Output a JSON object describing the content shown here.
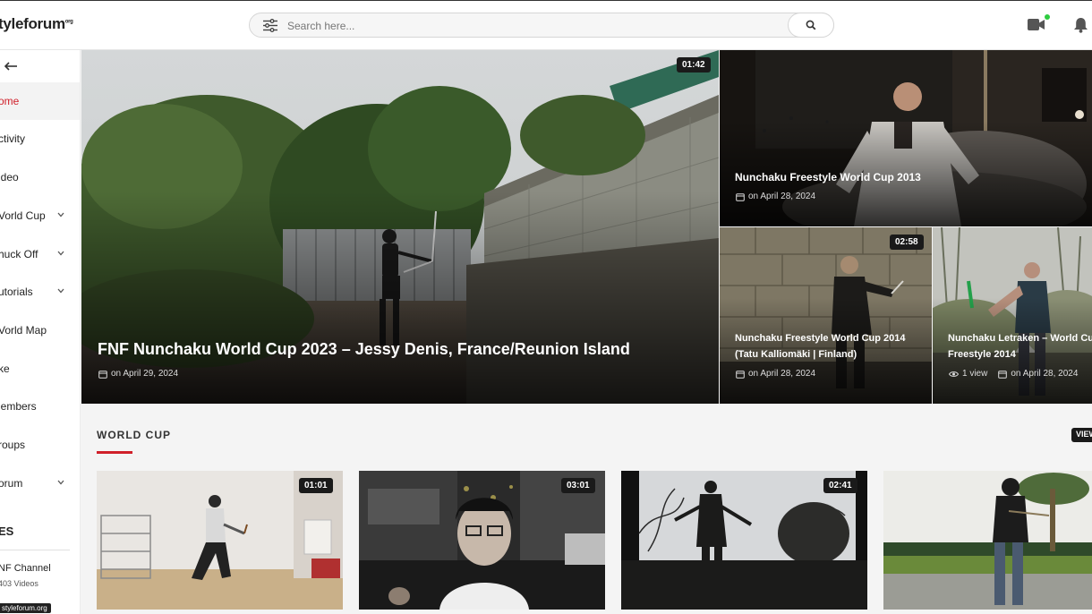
{
  "header": {
    "logo_text": "tyleforum",
    "logo_sup": "org",
    "search_placeholder": "Search here...",
    "icons": [
      "filter-icon",
      "search-icon",
      "video-camera-icon",
      "bell-icon"
    ],
    "online_dot_color": "#2ecc40"
  },
  "sidebar": {
    "items": [
      {
        "label": "ome",
        "active": true,
        "has_chevron": false
      },
      {
        "label": "ctivity",
        "has_chevron": false
      },
      {
        "label": "ideo",
        "has_chevron": false
      },
      {
        "label": "Vorld Cup",
        "has_chevron": true
      },
      {
        "label": "huck Off",
        "has_chevron": true
      },
      {
        "label": "utorials",
        "has_chevron": true
      },
      {
        "label": "Vorld Map",
        "has_chevron": false
      },
      {
        "label": "ke",
        "has_chevron": false
      },
      {
        "label": "lembers",
        "has_chevron": false
      },
      {
        "label": "roups",
        "has_chevron": false
      },
      {
        "label": "orum",
        "has_chevron": true
      }
    ],
    "section_heading": "ES",
    "channel": {
      "name": "NF Channel",
      "count": "403 Videos"
    },
    "tooltip": "styleforum.org",
    "active_color": "#d0202a"
  },
  "featured": {
    "main": {
      "title": "FNF Nunchaku World Cup 2023 – Jessy Denis, France/Reunion Island",
      "date": "on April 29, 2024",
      "duration": "01:42"
    },
    "top_right": {
      "title": "Nunchaku Freestyle World Cup 2013",
      "date": "on April 28, 2024"
    },
    "bottom_left": {
      "title": "Nunchaku Freestyle World Cup 2014 (Tatu Kalliomäki | Finland)",
      "date": "on April 28, 2024",
      "duration": "02:58"
    },
    "bottom_right": {
      "title": "Nunchaku Letraken – World Cup Freestyle 2014",
      "views": "1 view",
      "date": "on April 28, 2024"
    }
  },
  "world_cup": {
    "heading": "WORLD CUP",
    "view_all": "VIEW",
    "accent": "#d0202a",
    "cards": [
      {
        "duration": "01:01"
      },
      {
        "duration": "03:01"
      },
      {
        "duration": "02:41"
      },
      {
        "duration": ""
      }
    ]
  }
}
